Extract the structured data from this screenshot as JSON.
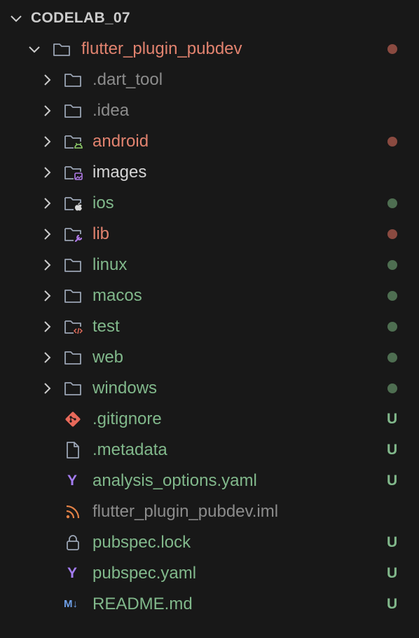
{
  "root": {
    "title": "CODELAB_07",
    "chevron": "chevron-down-icon"
  },
  "project": {
    "label": "flutter_plugin_pubdev",
    "icon": "folder-open-icon",
    "status": "modified",
    "dot_color": "#8a4a40"
  },
  "colors": {
    "modified": "#e2836f",
    "untracked": "#81b88b",
    "ignored": "#8c8c8c",
    "dot_modified": "#8a4a40",
    "dot_untracked": "#4e6e51",
    "badge_untracked": "#81b88b"
  },
  "items": [
    {
      "label": ".dart_tool",
      "kind": "folder",
      "icon": "folder-icon",
      "status": "ignored"
    },
    {
      "label": ".idea",
      "kind": "folder",
      "icon": "folder-icon",
      "status": "ignored"
    },
    {
      "label": "android",
      "kind": "folder",
      "icon": "android-folder-icon",
      "status": "modified",
      "decoration": "dot"
    },
    {
      "label": "images",
      "kind": "folder",
      "icon": "images-folder-icon",
      "status": "normal"
    },
    {
      "label": "ios",
      "kind": "folder",
      "icon": "apple-folder-icon",
      "status": "untracked",
      "decoration": "dot"
    },
    {
      "label": "lib",
      "kind": "folder",
      "icon": "lib-folder-icon",
      "status": "modified",
      "decoration": "dot"
    },
    {
      "label": "linux",
      "kind": "folder",
      "icon": "folder-icon",
      "status": "untracked",
      "decoration": "dot"
    },
    {
      "label": "macos",
      "kind": "folder",
      "icon": "folder-icon",
      "status": "untracked",
      "decoration": "dot"
    },
    {
      "label": "test",
      "kind": "folder",
      "icon": "test-folder-icon",
      "status": "untracked",
      "decoration": "dot"
    },
    {
      "label": "web",
      "kind": "folder",
      "icon": "folder-icon",
      "status": "untracked",
      "decoration": "dot"
    },
    {
      "label": "windows",
      "kind": "folder",
      "icon": "folder-icon",
      "status": "untracked",
      "decoration": "dot"
    },
    {
      "label": ".gitignore",
      "kind": "file",
      "icon": "git-icon",
      "status": "untracked",
      "badge": "U"
    },
    {
      "label": ".metadata",
      "kind": "file",
      "icon": "file-icon",
      "status": "untracked",
      "badge": "U"
    },
    {
      "label": "analysis_options.yaml",
      "kind": "file",
      "icon": "yaml-icon",
      "status": "untracked",
      "badge": "U"
    },
    {
      "label": "flutter_plugin_pubdev.iml",
      "kind": "file",
      "icon": "rss-icon",
      "status": "ignored"
    },
    {
      "label": "pubspec.lock",
      "kind": "file",
      "icon": "lock-icon",
      "status": "untracked",
      "badge": "U"
    },
    {
      "label": "pubspec.yaml",
      "kind": "file",
      "icon": "yaml-icon",
      "status": "untracked",
      "badge": "U"
    },
    {
      "label": "README.md",
      "kind": "file",
      "icon": "markdown-icon",
      "status": "untracked",
      "badge": "U"
    }
  ],
  "icon_glyphs": {
    "yaml": "Y",
    "markdown": "M↓"
  }
}
